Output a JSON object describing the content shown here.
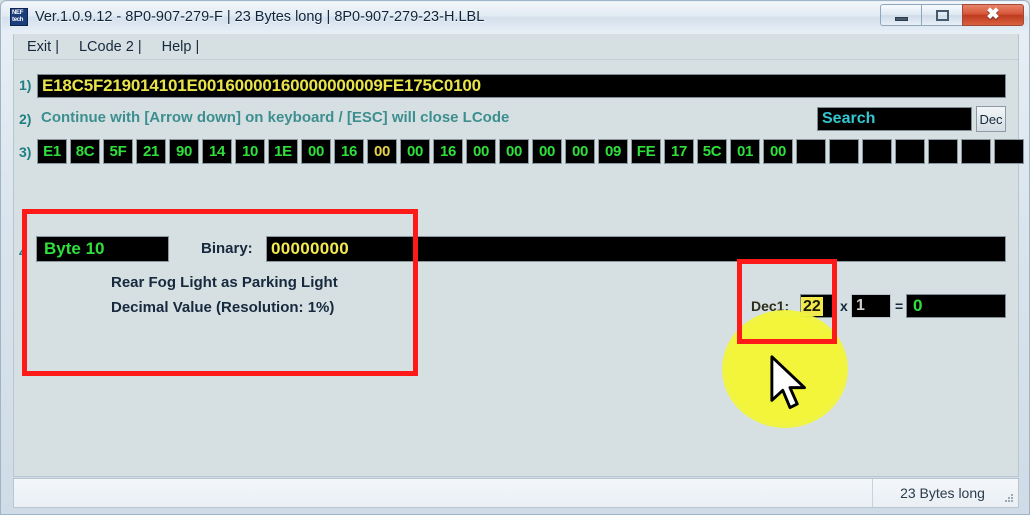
{
  "window": {
    "title": "Ver.1.0.9.12 -   8P0-907-279-F | 23 Bytes long | 8P0-907-279-23-H.LBL",
    "icon_label": "NEF tech",
    "buttons": {
      "minimize": "–",
      "maximize": "□",
      "close": "✕"
    }
  },
  "menu": {
    "items": [
      {
        "label": "Exit |"
      },
      {
        "label": "LCode 2 |"
      },
      {
        "label": "Help |"
      }
    ]
  },
  "rows": {
    "num1": "1)",
    "num2": "2)",
    "num3": "3)",
    "num4": "4"
  },
  "hex_string": {
    "value": "E18C5F219014101E00160000160000000009FE175C0100"
  },
  "hint": {
    "text": "Continue with [Arrow down] on keyboard / [ESC] will close LCode"
  },
  "search": {
    "value": "Search",
    "placeholder": "Search",
    "dec_button_label": "Dec"
  },
  "bytes": {
    "selected_index": 10,
    "cells": [
      "E1",
      "8C",
      "5F",
      "21",
      "90",
      "14",
      "10",
      "1E",
      "00",
      "16",
      "00",
      "00",
      "16",
      "00",
      "00",
      "00",
      "00",
      "09",
      "FE",
      "17",
      "5C",
      "01",
      "00",
      "",
      "",
      "",
      "",
      "",
      "",
      ""
    ]
  },
  "detail": {
    "byte_label": "Byte 10",
    "binary_label": "Binary:",
    "binary_value": "00000000",
    "description_line1": "Rear Fog Light as Parking Light",
    "description_line2": "Decimal Value (Resolution: 1%)"
  },
  "calc": {
    "dec1_label": "Dec1:",
    "dec1_value": "22",
    "times_symbol": "x",
    "multiplier_value": "1",
    "equals_symbol": "=",
    "result_value": "0"
  },
  "statusbar": {
    "bytes_long": "23 Bytes long"
  },
  "colors": {
    "background": "#d6e0e3",
    "hex_yellow": "#e8e34a",
    "byte_green": "#2fe03c",
    "byte_selected_yellow": "#e8d24a",
    "hint_teal": "#3d8f8f",
    "search_cyan": "#34c6cf",
    "annotation_red": "#ff1a1a",
    "cursor_halo_yellow": "#f2f53a"
  },
  "icons": {
    "app": "app-logo-icon",
    "minimize": "window-minimize-icon",
    "maximize": "window-maximize-icon",
    "close": "window-close-icon",
    "cursor": "mouse-pointer-icon",
    "resize_grip": "resize-grip-icon"
  }
}
